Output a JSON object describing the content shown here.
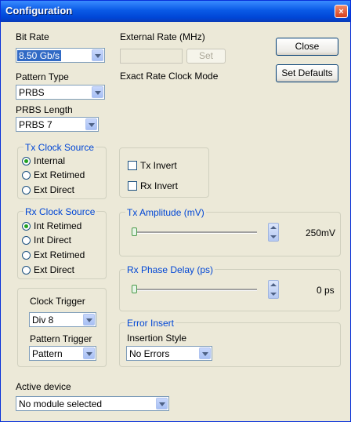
{
  "window": {
    "title": "Configuration",
    "close_glyph": "×"
  },
  "bit_rate": {
    "label": "Bit Rate",
    "value": "8.50 Gb/s"
  },
  "pattern_type": {
    "label": "Pattern Type",
    "value": "PRBS"
  },
  "prbs_length": {
    "label": "PRBS Length",
    "value": "PRBS 7"
  },
  "external_rate": {
    "label": "External Rate (MHz)",
    "value": "",
    "set_label": "Set",
    "mode_text": "Exact Rate Clock Mode"
  },
  "buttons": {
    "close": "Close",
    "set_defaults": "Set Defaults"
  },
  "tx_clock_source": {
    "title": "Tx Clock Source",
    "options": [
      {
        "label": "Internal",
        "selected": true
      },
      {
        "label": "Ext Retimed",
        "selected": false
      },
      {
        "label": "Ext Direct",
        "selected": false
      }
    ]
  },
  "rx_clock_source": {
    "title": "Rx Clock Source",
    "options": [
      {
        "label": "Int Retimed",
        "selected": true
      },
      {
        "label": "Int Direct",
        "selected": false
      },
      {
        "label": "Ext Retimed",
        "selected": false
      },
      {
        "label": "Ext Direct",
        "selected": false
      }
    ]
  },
  "invert": {
    "tx_label": "Tx Invert",
    "tx_checked": false,
    "rx_label": "Rx Invert",
    "rx_checked": false
  },
  "tx_amplitude": {
    "title": "Tx Amplitude (mV)",
    "value": "250mV"
  },
  "rx_phase_delay": {
    "title": "Rx Phase Delay (ps)",
    "value": "0 ps"
  },
  "clock_trigger": {
    "label": "Clock Trigger",
    "value": "Div 8"
  },
  "pattern_trigger": {
    "label": "Pattern Trigger",
    "value": "Pattern"
  },
  "error_insert": {
    "title": "Error Insert",
    "style_label": "Insertion Style",
    "value": "No Errors"
  },
  "active_device": {
    "label": "Active device",
    "value": "No module selected"
  },
  "colors": {
    "title_bar": "#0a5ae6",
    "group_title": "#0046d5",
    "selection": "#316ac5",
    "window_bg": "#ece9d8"
  },
  "icons": {
    "radio_on": "radio-selected-icon",
    "spin": "spinner-icon",
    "dropdown": "chevron-down-icon"
  }
}
